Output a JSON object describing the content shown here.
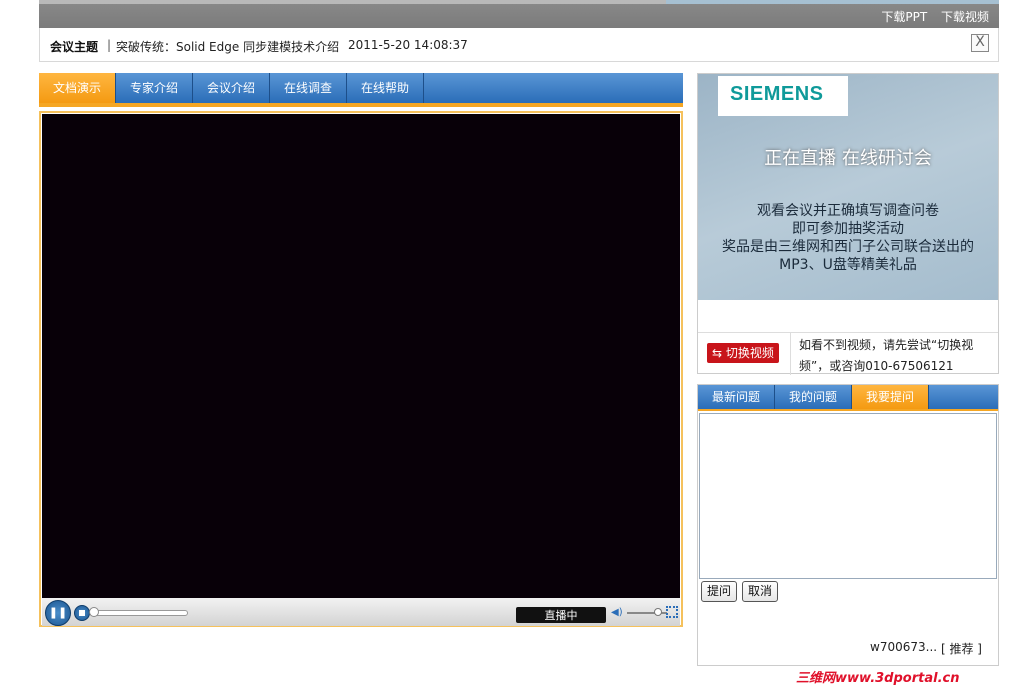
{
  "top_links": {
    "download_ppt": "下载PPT",
    "download_video": "下载视频"
  },
  "topic": {
    "label": "会议主题",
    "separator": "|",
    "title": "突破传统：Solid Edge 同步建模技术介绍",
    "datetime": "2011-5-20 14:08:37",
    "close_icon": "X"
  },
  "main_tabs": [
    {
      "label": "文档演示",
      "active": true
    },
    {
      "label": "专家介绍",
      "active": false
    },
    {
      "label": "会议介绍",
      "active": false
    },
    {
      "label": "在线调查",
      "active": false
    },
    {
      "label": "在线帮助",
      "active": false
    }
  ],
  "player": {
    "pause_icon": "pause-icon",
    "live_label": "直播中",
    "volume_icon": "speaker-icon"
  },
  "ad": {
    "logo": "SIEMENS",
    "headline": "正在直播  在线研讨会",
    "body_lines": [
      "观看会议并正确填写调查问卷",
      "即可参加抽奖活动",
      "奖品是由三维网和西门子公司联合送出的",
      "MP3、U盘等精美礼品"
    ],
    "switch_button": "切换视频",
    "switch_icon": "switch-icon",
    "switch_note": "如看不到视频，请先尝试“切换视频”，或咨询010-67506121"
  },
  "questions": {
    "tabs": [
      {
        "label": "最新问题",
        "active": false
      },
      {
        "label": "我的问题",
        "active": false
      },
      {
        "label": "我要提问",
        "active": true
      }
    ],
    "ask_button": "提问",
    "cancel_button": "取消",
    "user": "w700673...",
    "recommend": "[ 推荐 ]"
  },
  "watermark": "三维网www.3dportal.cn"
}
